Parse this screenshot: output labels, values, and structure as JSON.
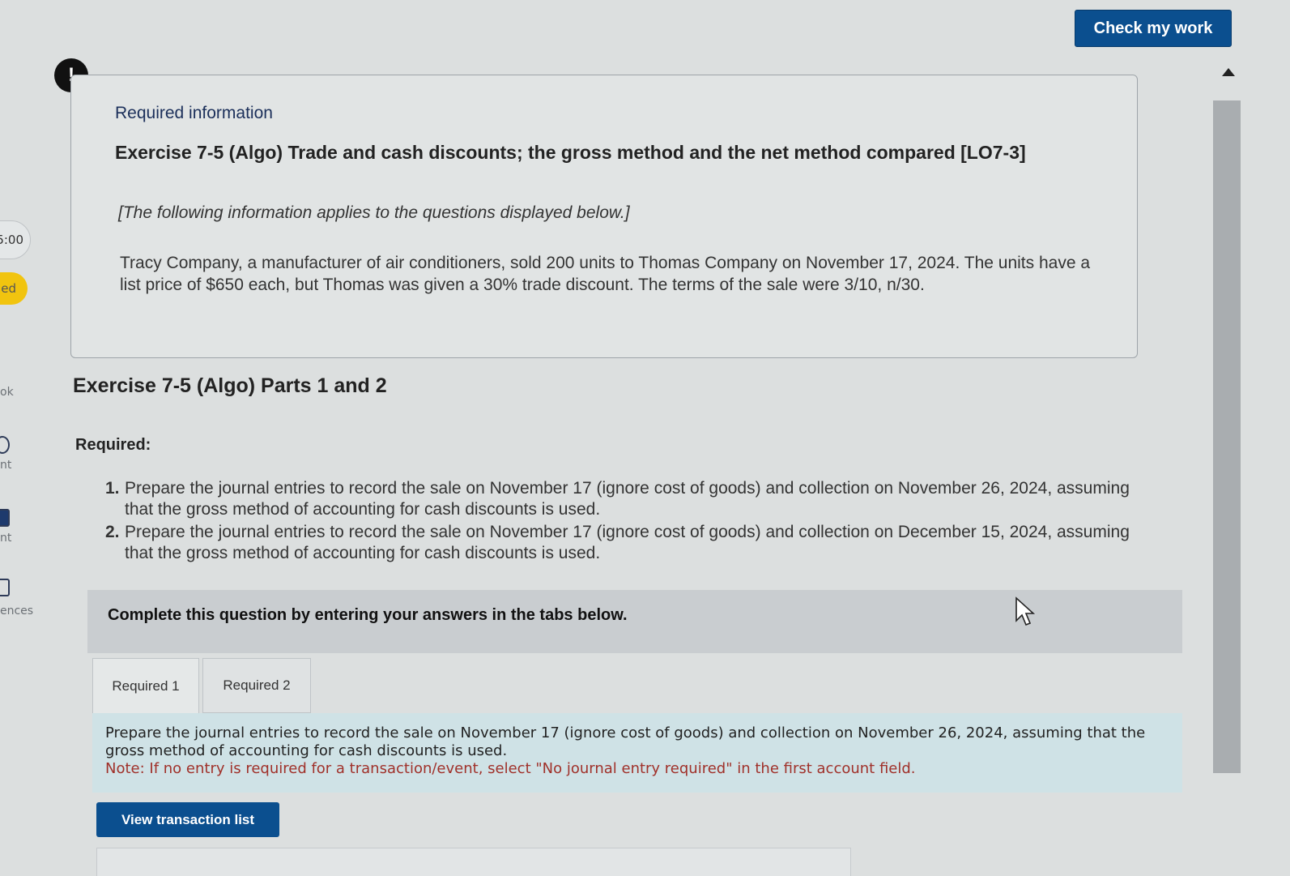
{
  "sidebar": {
    "timer": "5:00",
    "badge": "ed",
    "labels": [
      "ok",
      "nt",
      "nt",
      "ences"
    ]
  },
  "header": {
    "check_button": "Check my work"
  },
  "info_box": {
    "heading": "Required information",
    "exercise_title": "Exercise 7-5 (Algo) Trade and cash discounts; the gross method and the net method compared [LO7-3]",
    "applies_note": "[The following information applies to the questions displayed below.]",
    "scenario": "Tracy Company, a manufacturer of air conditioners, sold 200 units to Thomas Company on November 17, 2024. The units have a list price of $650 each, but Thomas was given a 30% trade discount. The terms of the sale were 3/10, n/30."
  },
  "main": {
    "parts_title": "Exercise 7-5 (Algo) Parts 1 and 2",
    "required_label": "Required:",
    "requirements": [
      {
        "num": "1.",
        "text": "Prepare the journal entries to record the sale on November 17 (ignore cost of goods) and collection on November 26, 2024, assuming that the gross method of accounting for cash discounts is used."
      },
      {
        "num": "2.",
        "text": "Prepare the journal entries to record the sale on November 17 (ignore cost of goods) and collection on December 15, 2024, assuming that the gross method of accounting for cash discounts is used."
      }
    ],
    "complete_prompt": "Complete this question by entering your answers in the tabs below.",
    "tabs": [
      {
        "label": "Required 1"
      },
      {
        "label": "Required 2"
      }
    ],
    "instruction": "Prepare the journal entries to record the sale on November 17 (ignore cost of goods) and collection on November 26, 2024, assuming that the gross method of accounting for cash discounts is used.",
    "note": "Note: If no entry is required for a transaction/event, select \"No journal entry required\" in the first account field.",
    "view_button": "View transaction list"
  },
  "colors": {
    "primary_button": "#0b4f8f",
    "note_red": "#a0312a",
    "instruction_bg": "#cfe2e6",
    "badge_yellow": "#f1c40f"
  }
}
